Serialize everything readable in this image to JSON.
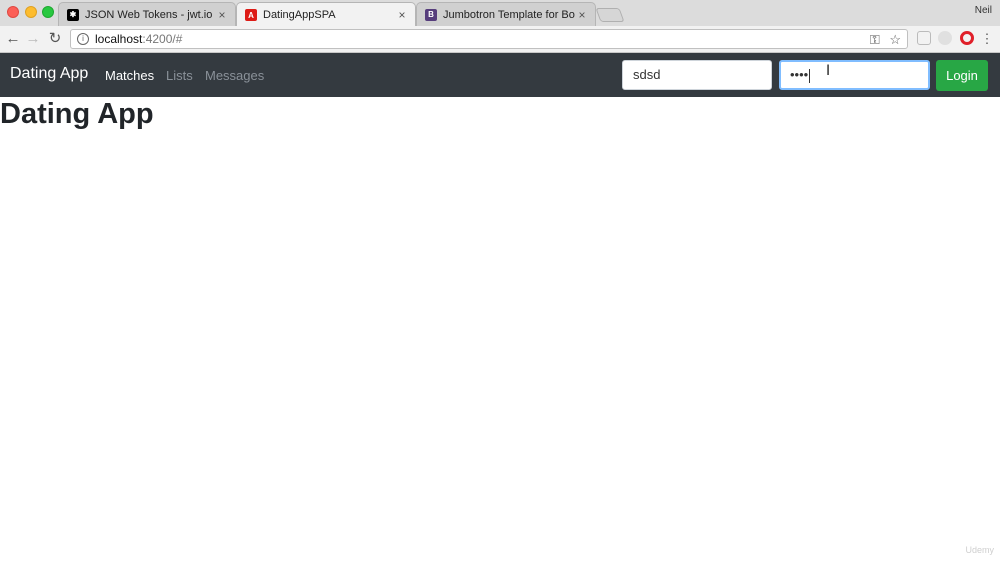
{
  "browser": {
    "tabs": [
      {
        "title": "JSON Web Tokens - jwt.io",
        "icon": "jwt-icon",
        "color": "#000000"
      },
      {
        "title": "DatingAppSPA",
        "icon": "angular-icon",
        "color": "#dd1b16"
      },
      {
        "title": "Jumbotron Template for Boots",
        "icon": "bootstrap-icon",
        "color": "#563d7c"
      }
    ],
    "profile_name": "Neil",
    "url_host": "localhost",
    "url_path": ":4200/#",
    "close_glyph": "×"
  },
  "navbar": {
    "brand": "Dating App",
    "links": [
      "Matches",
      "Lists",
      "Messages"
    ],
    "username_value": "sdsd",
    "password_mask": "••••",
    "login_label": "Login",
    "bg_color": "#343a40",
    "login_color": "#28a745"
  },
  "main": {
    "heading": "Dating App"
  },
  "watermark": "Udemy"
}
